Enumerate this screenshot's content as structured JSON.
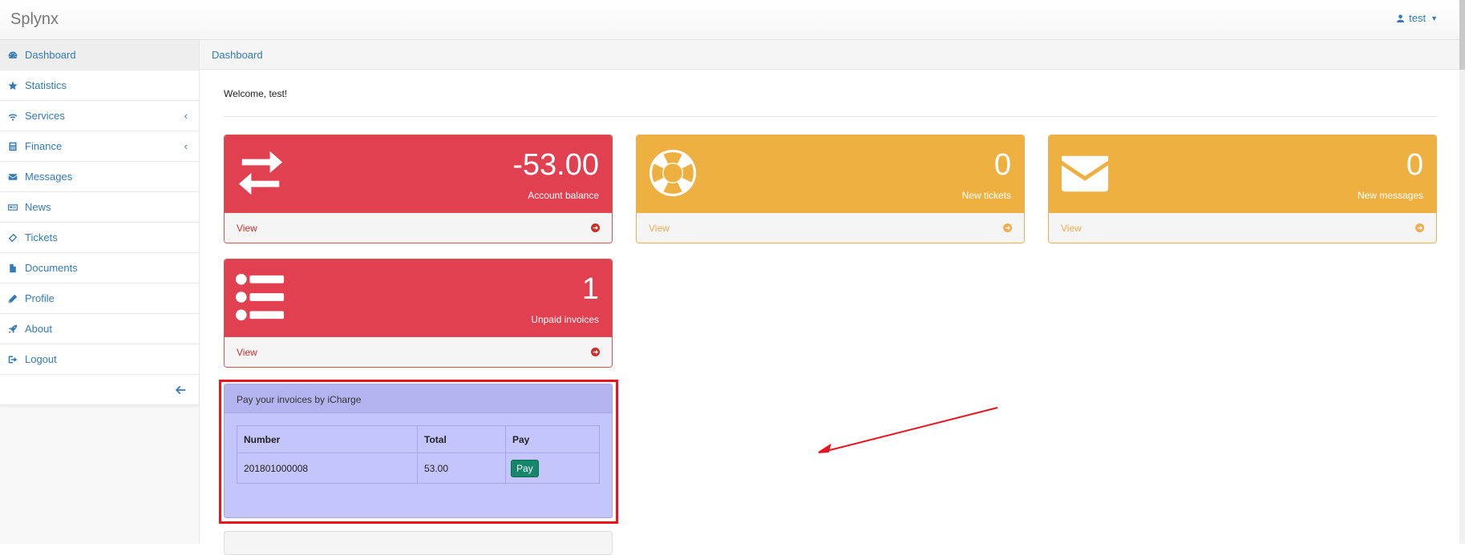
{
  "app": {
    "brand": "Splynx",
    "user": "test"
  },
  "sidebar": {
    "items": [
      {
        "label": "Dashboard",
        "icon": "dashboard-icon"
      },
      {
        "label": "Statistics",
        "icon": "star-icon"
      },
      {
        "label": "Services",
        "icon": "wifi-icon",
        "has_submenu": true
      },
      {
        "label": "Finance",
        "icon": "calculator-icon",
        "has_submenu": true
      },
      {
        "label": "Messages",
        "icon": "envelope-icon"
      },
      {
        "label": "News",
        "icon": "newspaper-icon"
      },
      {
        "label": "Tickets",
        "icon": "ticket-icon"
      },
      {
        "label": "Documents",
        "icon": "file-icon"
      },
      {
        "label": "Profile",
        "icon": "pencil-icon"
      },
      {
        "label": "About",
        "icon": "rocket-icon"
      },
      {
        "label": "Logout",
        "icon": "sign-out-icon"
      }
    ],
    "active": "Dashboard"
  },
  "breadcrumb": "Dashboard",
  "welcome": "Welcome, test!",
  "cards": {
    "balance": {
      "value": "-53.00",
      "caption": "Account balance",
      "link": "View",
      "color": "#e04050",
      "icon": "exchange-icon"
    },
    "tickets": {
      "value": "0",
      "caption": "New tickets",
      "link": "View",
      "color": "#efb042",
      "icon": "life-ring-icon"
    },
    "messages": {
      "value": "0",
      "caption": "New messages",
      "link": "View",
      "color": "#efb042",
      "icon": "envelope-icon"
    },
    "invoices": {
      "value": "1",
      "caption": "Unpaid invoices",
      "link": "View",
      "color": "#e04050",
      "icon": "list-icon"
    }
  },
  "pay_panel": {
    "title": "Pay your invoices by iCharge",
    "columns": [
      "Number",
      "Total",
      "Pay"
    ],
    "rows": [
      {
        "number": "201801000008",
        "total": "53.00",
        "action": "Pay"
      }
    ]
  },
  "colors": {
    "accent": "#337ab7",
    "danger": "#e04050",
    "warning": "#efb042",
    "highlight": "#e8141e"
  }
}
